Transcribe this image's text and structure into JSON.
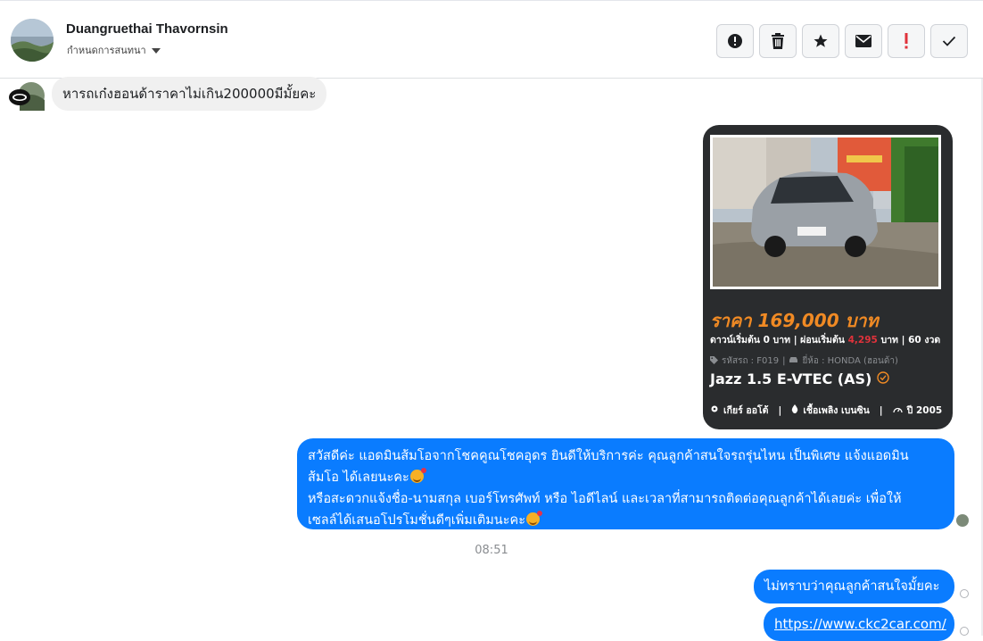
{
  "header": {
    "contact_name": "Duangruethai Thavornsin",
    "assign_label": "กำหนดการสนทนา",
    "actions": [
      {
        "icon": "alert-circle-icon",
        "name": "report-button"
      },
      {
        "icon": "trash-icon",
        "name": "delete-button"
      },
      {
        "icon": "star-icon",
        "name": "star-button"
      },
      {
        "icon": "envelope-icon",
        "name": "mark-unread-button"
      },
      {
        "icon": "exclamation-icon",
        "name": "spam-button"
      },
      {
        "icon": "checkmark-icon",
        "name": "done-button"
      }
    ]
  },
  "messages": {
    "incoming_1": "หารถเก๋งฮอนด้าราคาไม่เกิน200000มีมั้ยคะ",
    "card": {
      "price": "ราคา 169,000 บาท",
      "terms_prefix": "ดาวน์เริ่มต้น 0 บาท | ผ่อนเริ่มต้น ",
      "terms_installment": "4,295",
      "terms_suffix": " บาท | 60 งวด",
      "code_label": "รหัสรถ : F019",
      "brand_label": "ยี่ห้อ : HONDA (ฮอนด้า)",
      "model": "Jazz 1.5 E-VTEC (AS)",
      "gear": "เกียร์ ออโต้",
      "fuel": "เชื้อเพลิง เบนซิน",
      "year": "ปี 2005"
    },
    "outgoing_1_line1": "สวัสดีค่ะ แอดมินส้มโอจากโชคคูณโชคอุดร ยินดีให้บริการค่ะ   คุณลูกค้าสนใจรถรุ่นไหน เป็นพิเศษ แจ้งแอดมิน",
    "outgoing_1_line2": "ส้มโอ ได้เลยนะคะ",
    "outgoing_1_line3": "หรือสะดวกแจ้งชื่อ-นามสกุล เบอร์โทรศัพท์ หรือ ไอดีไลน์ และเวลาที่สามารถติดต่อคุณลูกค้าได้เลยค่ะ เพื่อให้",
    "outgoing_1_line4": "เซลล์ได้เสนอโปรโมชั่นดีๆเพิ่มเติมนะคะ",
    "timestamp": "08:51",
    "outgoing_2": "ไม่ทราบว่าคุณลูกค้าสนใจมั้ยคะ",
    "outgoing_3": "https://www.ckc2car.com/"
  },
  "colors": {
    "accent_blue": "#0a7cff",
    "price_orange": "#f08a24",
    "installment_red": "#e0323b",
    "card_bg": "#2a2c2e"
  }
}
